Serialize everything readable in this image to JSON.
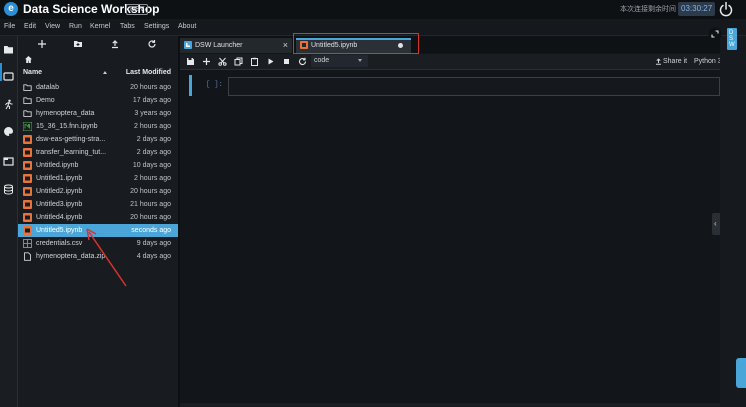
{
  "header": {
    "title": "Data Science Workshop",
    "badge": "DEV",
    "time_label": "本次连接剩余时间",
    "timer": "03:30:27"
  },
  "menu": [
    "File",
    "Edit",
    "View",
    "Run",
    "Kernel",
    "Tabs",
    "Settings",
    "About"
  ],
  "browser": {
    "col_name": "Name",
    "col_modified": "Last Modified",
    "files": [
      {
        "name": "datalab",
        "modified": "20 hours ago",
        "icon": "folder-icon"
      },
      {
        "name": "Demo",
        "modified": "17 days ago",
        "icon": "folder-icon"
      },
      {
        "name": "hymenoptera_data",
        "modified": "3 years ago",
        "icon": "folder-icon"
      },
      {
        "name": "15_36_15.fnn.ipynb",
        "modified": "2 hours ago",
        "icon": "notebook-icon-green"
      },
      {
        "name": "dsw-eas-getting-stra...",
        "modified": "2 days ago",
        "icon": "notebook-icon"
      },
      {
        "name": "transfer_learning_tut...",
        "modified": "2 days ago",
        "icon": "notebook-icon"
      },
      {
        "name": "Untitled.ipynb",
        "modified": "10 days ago",
        "icon": "notebook-icon"
      },
      {
        "name": "Untitled1.ipynb",
        "modified": "2 hours ago",
        "icon": "notebook-icon"
      },
      {
        "name": "Untitled2.ipynb",
        "modified": "20 hours ago",
        "icon": "notebook-icon"
      },
      {
        "name": "Untitled3.ipynb",
        "modified": "21 hours ago",
        "icon": "notebook-icon"
      },
      {
        "name": "Untitled4.ipynb",
        "modified": "20 hours ago",
        "icon": "notebook-icon"
      },
      {
        "name": "Untitled5.ipynb",
        "modified": "seconds ago",
        "icon": "notebook-icon",
        "selected": true
      },
      {
        "name": "credentials.csv",
        "modified": "9 days ago",
        "icon": "csv-icon"
      },
      {
        "name": "hymenoptera_data.zip",
        "modified": "4 days ago",
        "icon": "file-icon"
      }
    ]
  },
  "tabs": [
    {
      "label": "DSW Launcher"
    },
    {
      "label": "Untitled5.ipynb"
    }
  ],
  "toolbar": {
    "cell_type": "code",
    "share": "Share it",
    "kernel": "Python 3"
  },
  "cell": {
    "prompt": "[ ]:"
  },
  "side_tab": "DSW",
  "colors": {
    "accent": "#4aa6d8",
    "highlight": "#d8332c",
    "notebook": "#e8743b",
    "csv": "#4caf50"
  }
}
